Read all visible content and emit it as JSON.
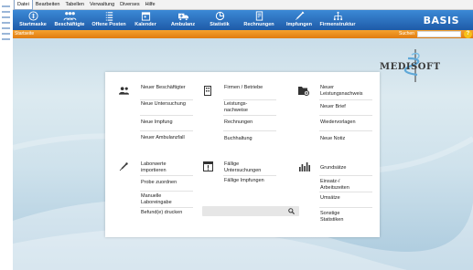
{
  "menu": [
    "Datei",
    "Bearbeiten",
    "Tabellen",
    "Verwaltung",
    "Diverses",
    "Hilfe"
  ],
  "toolbar": [
    {
      "label": "Startmaske",
      "icon": "start-icon"
    },
    {
      "label": "Beschäftigte",
      "icon": "people-icon"
    },
    {
      "label": "Offene Posten",
      "icon": "list-icon"
    },
    {
      "label": "Kalender",
      "icon": "calendar-icon"
    },
    {
      "label": "Ambulanz",
      "icon": "ambulance-icon"
    },
    {
      "label": "Statistik",
      "icon": "pie-chart-icon"
    },
    {
      "label": "Rechnungen",
      "icon": "invoice-icon"
    },
    {
      "label": "Impfungen",
      "icon": "syringe-icon"
    },
    {
      "label": "Firmenstruktur",
      "icon": "hierarchy-icon"
    }
  ],
  "brand": "BASIS",
  "tabbar": {
    "tab": "Startseite",
    "search_label": "Suchen",
    "help": "?"
  },
  "logo_text": "MEDISOFT",
  "links": {
    "neuer_beschaeftigter": "Neuer Beschäftigter",
    "neue_untersuchung": "Neue Untersuchung",
    "neue_impfung": "Neue Impfung",
    "neuer_ambulanzfall": "Neuer Ambulanzfall",
    "firmen_betriebe": "Firmen / Betriebe",
    "leistungsnachweise": "Leistungs-nachweise",
    "rechnungen": "Rechnungen",
    "buchhaltung": "Buchhaltung",
    "neuer_leistungsnachweis": "Neuer Leistungsnachweis",
    "neuer_brief": "Neuer Brief",
    "wiedervorlagen": "Wiedervorlagen",
    "neue_notiz": "Neue Notiz",
    "laborwerte_importieren": "Laborwerte importieren",
    "probe_zuordnen": "Probe zuordnen",
    "manuelle_laboreingabe": "Manuelle Laboreingabe",
    "befunde_drucken": "Befund(e) drucken",
    "faellige_untersuchungen": "Fällige Untersuchungen",
    "faellige_impfungen": "Fällige Impfungen",
    "grundsaetze": "Grundsätze",
    "einsatz_arbeitszeiten": "Einsatz-/ Arbeitszeiten",
    "umsaetze": "Umsätze",
    "sonstige_statistiken": "Sonstige Statistiken"
  },
  "colors": {
    "toolbar": "#2a70c2",
    "tabbar": "#ec8e1c",
    "accent": "#f7c21a"
  }
}
